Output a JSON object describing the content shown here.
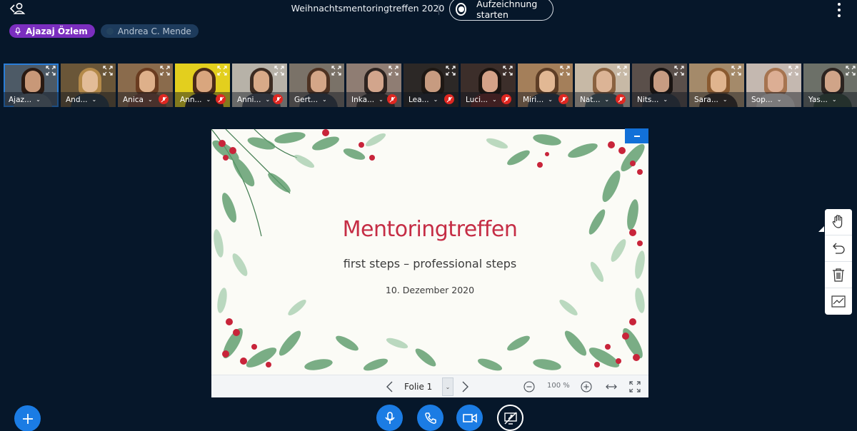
{
  "header": {
    "meeting_title": "Weihnachtsmentoringtreffen 2020",
    "record_label": "Aufzeichnung starten"
  },
  "talkers": [
    {
      "name": "Ajazaj Özlem",
      "active": true
    },
    {
      "name": "Andrea C. Mende",
      "active": false
    }
  ],
  "participants": [
    {
      "name": "Ajaz...",
      "bg": "#4d5a66",
      "face": "#c89878",
      "hair": "#2a1a12",
      "shirt": "#5f6a72",
      "speaking": true,
      "muted": false
    },
    {
      "name": "And...",
      "bg": "#6a5638",
      "face": "#e2bc98",
      "hair": "#b48a4a",
      "shirt": "#2f3b42",
      "speaking": false,
      "muted": false
    },
    {
      "name": "Anica",
      "bg": "#8a6b4c",
      "face": "#deb08a",
      "hair": "#6a3c20",
      "shirt": "#7a4b3a",
      "speaking": false,
      "muted": true
    },
    {
      "name": "Ann...",
      "bg": "#e3cf1e",
      "face": "#d9a67e",
      "hair": "#4a2a18",
      "shirt": "#262626",
      "speaking": false,
      "muted": true
    },
    {
      "name": "Anni...",
      "bg": "#b7b2a8",
      "face": "#d8aa88",
      "hair": "#3c2c22",
      "shirt": "#4c4f56",
      "speaking": false,
      "muted": true
    },
    {
      "name": "Gert...",
      "bg": "#7a7268",
      "face": "#d4a688",
      "hair": "#4e3222",
      "shirt": "#3a3f45",
      "speaking": false,
      "muted": false
    },
    {
      "name": "Inka...",
      "bg": "#8f7d73",
      "face": "#d2a58c",
      "hair": "#2e2420",
      "shirt": "#3a3430",
      "speaking": false,
      "muted": true
    },
    {
      "name": "Lea...",
      "bg": "#2c2826",
      "face": "#c79b80",
      "hair": "#1e1814",
      "shirt": "#2a2a2e",
      "speaking": false,
      "muted": true
    },
    {
      "name": "Luci...",
      "bg": "#3c2e2a",
      "face": "#d4a288",
      "hair": "#1c1410",
      "shirt": "#6a2a26",
      "speaking": false,
      "muted": true
    },
    {
      "name": "Miri...",
      "bg": "#a47f5a",
      "face": "#e2b894",
      "hair": "#5e3e26",
      "shirt": "#2e3a44",
      "speaking": false,
      "muted": true
    },
    {
      "name": "Nat...",
      "bg": "#c7b9a6",
      "face": "#dcb496",
      "hair": "#8a6240",
      "shirt": "#4a5a5e",
      "speaking": false,
      "muted": true
    },
    {
      "name": "Nits...",
      "bg": "#5a4f4a",
      "face": "#c79c82",
      "hair": "#1a1412",
      "shirt": "#343a40",
      "speaking": false,
      "muted": false
    },
    {
      "name": "Sara...",
      "bg": "#a48a6a",
      "face": "#e0b48e",
      "hair": "#8a5a30",
      "shirt": "#3a2e26",
      "speaking": false,
      "muted": false
    },
    {
      "name": "Sop...",
      "bg": "#c4b8b0",
      "face": "#dcae94",
      "hair": "#a67450",
      "shirt": "#d8d0c8",
      "speaking": false,
      "muted": false
    },
    {
      "name": "Yas...",
      "bg": "#6c7068",
      "face": "#d0a488",
      "hair": "#2c2420",
      "shirt": "#3a4a3a",
      "speaking": false,
      "muted": false
    }
  ],
  "slide": {
    "title": "Mentoringtreffen",
    "subtitle": "first steps – professional steps",
    "date": "10. Dezember 2020",
    "accent": "#c52d45"
  },
  "slide_toolbar": {
    "slide_label": "Folie 1",
    "zoom": "100 %"
  },
  "whiteboard_tools": [
    "hand-icon",
    "undo-icon",
    "trash-icon",
    "multi-user-icon"
  ],
  "bottom_bar": [
    "microphone-icon",
    "phone-icon",
    "camera-icon",
    "screenshare-off-icon"
  ],
  "colors": {
    "background": "#06172a",
    "primary": "#1b7ce4",
    "talker_active": "#7b2ebf",
    "muted": "#df2721"
  }
}
